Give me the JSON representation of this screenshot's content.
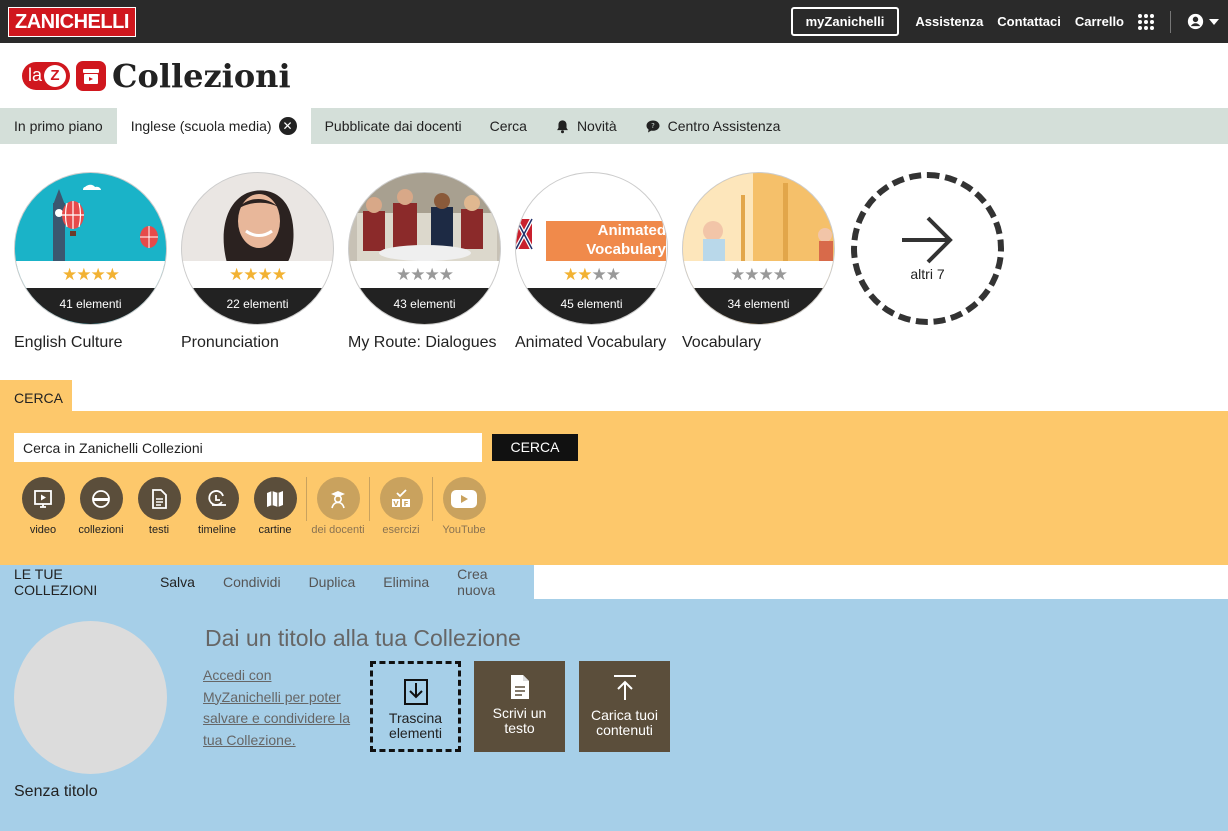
{
  "topbar": {
    "brand": "ZANICHELLI",
    "my": "myZanichelli",
    "assistenza": "Assistenza",
    "contattaci": "Contattaci",
    "carrello": "Carrello",
    "icons": [
      "apps-grid-icon",
      "user-icon",
      "caret-down-icon"
    ]
  },
  "header": {
    "la": "la",
    "z": "Z",
    "title": "Collezioni"
  },
  "tabs": [
    {
      "label": "In primo piano"
    },
    {
      "label": "Inglese (scuola media)",
      "active": true
    },
    {
      "label": "Pubblicate dai docenti"
    },
    {
      "label": "Cerca"
    },
    {
      "label": "Novità",
      "icon": "bell-icon"
    },
    {
      "label": "Centro Assistenza",
      "icon": "chat-icon"
    }
  ],
  "collections": [
    {
      "label": "English Culture",
      "count": "41 elementi",
      "stars": 4,
      "colors": [
        "#1ab3c8",
        "#ffffff"
      ]
    },
    {
      "label": "Pronunciation",
      "count": "22 elementi",
      "stars": 4,
      "colors": [
        "#e9e5e2",
        "#2b2220"
      ]
    },
    {
      "label": "My Route: Dialogues",
      "count": "43 elementi",
      "stars": 0,
      "colors": [
        "#8b2a2a",
        "#6c7b8c"
      ]
    },
    {
      "label": "Animated Vocabulary",
      "count": "45 elementi",
      "stars": 2,
      "colors": [
        "#ffffff",
        "#f08a4b"
      ],
      "banner": "Animated Vocabulary"
    },
    {
      "label": "Vocabulary",
      "count": "34 elementi",
      "stars": 0,
      "colors": [
        "#f5c06a",
        "#fde6bb"
      ]
    }
  ],
  "more": {
    "label": "altri 7"
  },
  "star_colors": {
    "on": "#f2b233",
    "off": "#999999"
  },
  "cerca": {
    "tab": "CERCA",
    "placeholder": "Cerca in Zanichelli Collezioni",
    "button": "CERCA"
  },
  "filters": [
    {
      "label": "video",
      "icon": "video-icon",
      "active": true
    },
    {
      "label": "collezioni",
      "icon": "collection-icon",
      "active": true
    },
    {
      "label": "testi",
      "icon": "document-icon",
      "active": true
    },
    {
      "label": "timeline",
      "icon": "timeline-icon",
      "active": true
    },
    {
      "label": "cartine",
      "icon": "map-icon",
      "active": true
    },
    {
      "label": "dei docenti",
      "icon": "teacher-icon",
      "active": false
    },
    {
      "label": "esercizi",
      "icon": "exercise-icon",
      "active": false
    },
    {
      "label": "YouTube",
      "icon": "youtube-icon",
      "active": false
    }
  ],
  "coll_tabs": [
    "LE TUE COLLEZIONI",
    "Salva",
    "Condividi",
    "Duplica",
    "Elimina",
    "Crea nuova"
  ],
  "collection": {
    "title_placeholder": "Dai un titolo alla tua Collezione",
    "login_text": "Accedi con MyZanichelli per poter salvare e condividere la tua Collezione.",
    "name": "Senza titolo",
    "actions": [
      {
        "label": "Trascina elementi",
        "icon": "drop-in-icon"
      },
      {
        "label": "Scrivi un testo",
        "icon": "write-doc-icon"
      },
      {
        "label": "Carica tuoi contenuti",
        "icon": "upload-icon"
      }
    ]
  },
  "colors": {
    "brand": "#d0171e",
    "cerca_bg": "#fdc86b",
    "coll_bg": "#a6cfe8",
    "tabs_bg": "#d4dfd9",
    "icon_brown": "#5b4e3b"
  }
}
